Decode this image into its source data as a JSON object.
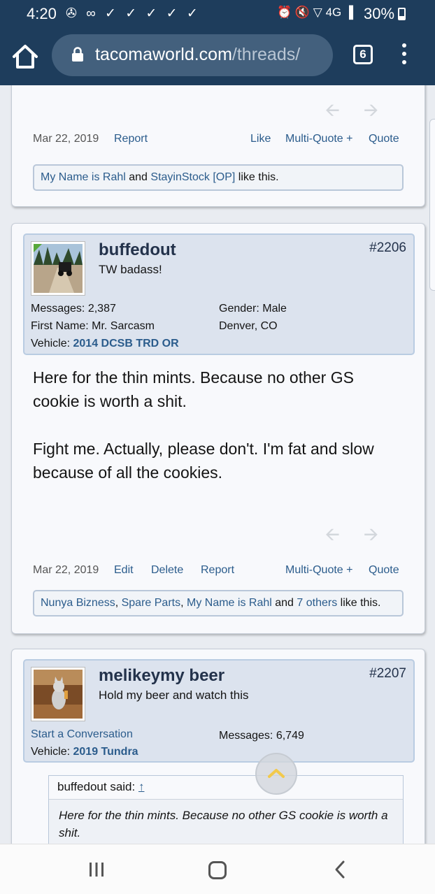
{
  "status_bar": {
    "time": "4:20",
    "notification_icons": "✇ ∞ ✓ ✓ ✓ ✓ ✓",
    "system_icons": "⏰ 🔇 ▽ 4G ▐",
    "battery": "30%"
  },
  "browser": {
    "url_domain": "tacomaworld.com",
    "url_path": "/threads/",
    "tab_count": "6"
  },
  "post_top": {
    "date": "Mar 22, 2019",
    "report": "Report",
    "like": "Like",
    "multiquote": "Multi-Quote +",
    "quote": "Quote",
    "likes": {
      "user1": "My Name is Rahl",
      "and1": " and ",
      "user2": "StayinStock [OP]",
      "tail": " like this."
    }
  },
  "post_2206": {
    "username": "buffedout",
    "user_title": "TW badass!",
    "post_number": "#2206",
    "messages_label": "Messages:",
    "messages_value": "2,387",
    "first_name_label": "First Name:",
    "first_name_value": "Mr. Sarcasm",
    "vehicle_label": "Vehicle:",
    "vehicle_value": "2014 DCSB TRD OR",
    "gender_label": "Gender:",
    "gender_value": "Male",
    "location": "Denver, CO",
    "body_p1": "Here for the thin mints. Because no other GS cookie is worth a shit.",
    "body_p2": "Fight me. Actually, please don't. I'm fat and slow because of all the cookies.",
    "date": "Mar 22, 2019",
    "edit": "Edit",
    "delete": "Delete",
    "report": "Report",
    "multiquote": "Multi-Quote +",
    "quote": "Quote",
    "likes": {
      "user1": "Nunya Bizness",
      "sep1": ", ",
      "user2": "Spare Parts",
      "sep2": ", ",
      "user3": "My Name is Rahl",
      "and": " and ",
      "others": "7 others",
      "tail": " like this."
    }
  },
  "post_2207": {
    "username": "melikeymy beer",
    "user_title": "Hold my beer and watch this",
    "post_number": "#2207",
    "start_conversation": "Start a Conversation",
    "messages_label": "Messages:",
    "messages_value": "6,749",
    "vehicle_label": "Vehicle:",
    "vehicle_value": "2019 Tundra",
    "quote_author": "buffedout said:",
    "quote_up": "↑",
    "quote_text": "Here for the thin mints. Because no other GS cookie is worth a shit."
  },
  "colors": {
    "header_bg": "#1e3d5c",
    "link": "#2b5c8c",
    "username": "#23324b",
    "userblock_bg": "#dce3ee"
  }
}
